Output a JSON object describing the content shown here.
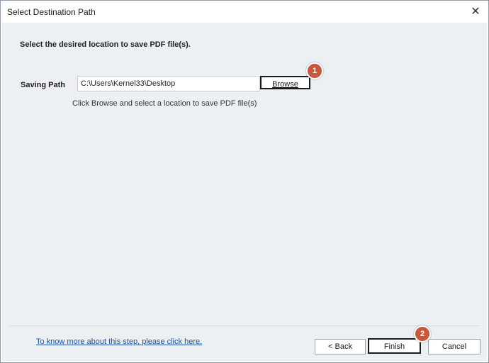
{
  "window": {
    "title": "Select Destination Path",
    "close_label": "✕"
  },
  "main": {
    "instruction": "Select the desired location to save PDF file(s).",
    "path_label": "Saving Path",
    "path_value": "C:\\Users\\Kernel33\\Desktop",
    "browse_label": "Browse",
    "hint": "Click Browse and select a location to save PDF file(s)"
  },
  "badges": {
    "first": "1",
    "second": "2"
  },
  "footer": {
    "help_link": "To know more about this step, please click here.",
    "back_label": "< Back",
    "finish_label": "Finish",
    "cancel_label": "Cancel"
  },
  "colors": {
    "badge": "#c8573c",
    "content_bg": "#edf0f2",
    "link": "#1e4e9a"
  }
}
